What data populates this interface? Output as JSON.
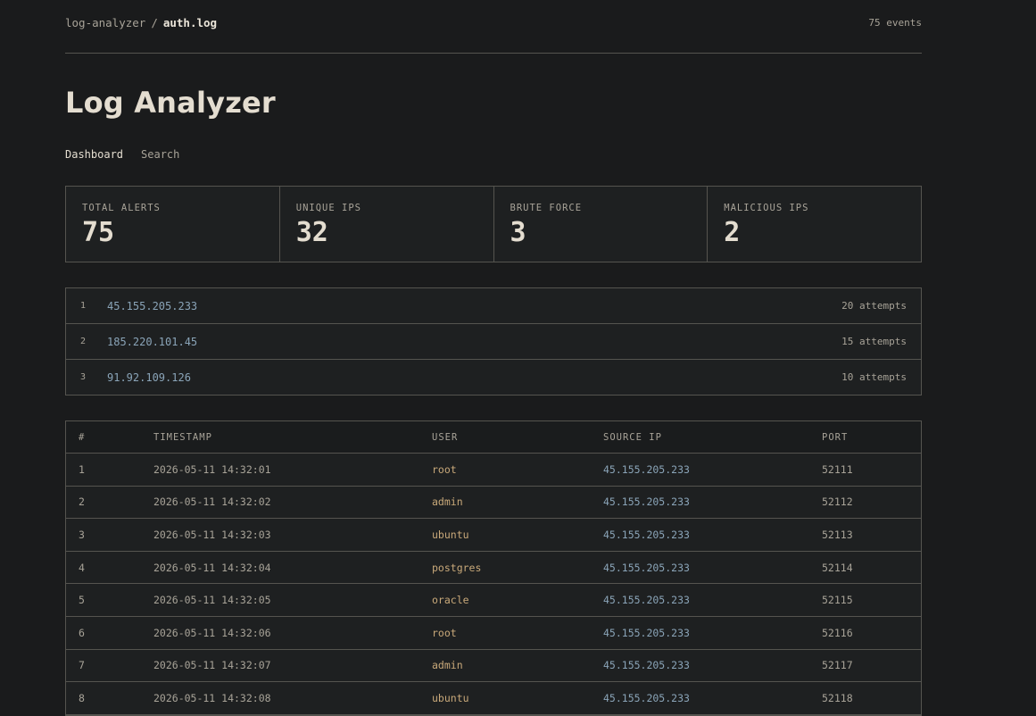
{
  "breadcrumb": {
    "app": "log-analyzer",
    "separator": "/",
    "file": "auth.log"
  },
  "event_count": "75 events",
  "title": "Log Analyzer",
  "tabs": [
    {
      "label": "Dashboard",
      "active": true
    },
    {
      "label": "Search",
      "active": false
    }
  ],
  "stats": [
    {
      "label": "TOTAL ALERTS",
      "value": "75"
    },
    {
      "label": "UNIQUE IPS",
      "value": "32"
    },
    {
      "label": "BRUTE FORCE",
      "value": "3"
    },
    {
      "label": "MALICIOUS IPS",
      "value": "2"
    }
  ],
  "top_ips": [
    {
      "rank": "1",
      "ip": "45.155.205.233",
      "attempts": "20 attempts"
    },
    {
      "rank": "2",
      "ip": "185.220.101.45",
      "attempts": "15 attempts"
    },
    {
      "rank": "3",
      "ip": "91.92.109.126",
      "attempts": "10 attempts"
    }
  ],
  "events": {
    "columns": [
      "#",
      "TIMESTAMP",
      "USER",
      "SOURCE IP",
      "PORT"
    ],
    "rows": [
      {
        "num": "1",
        "ts": "2026-05-11 14:32:01",
        "user": "root",
        "ip": "45.155.205.233",
        "port": "52111"
      },
      {
        "num": "2",
        "ts": "2026-05-11 14:32:02",
        "user": "admin",
        "ip": "45.155.205.233",
        "port": "52112"
      },
      {
        "num": "3",
        "ts": "2026-05-11 14:32:03",
        "user": "ubuntu",
        "ip": "45.155.205.233",
        "port": "52113"
      },
      {
        "num": "4",
        "ts": "2026-05-11 14:32:04",
        "user": "postgres",
        "ip": "45.155.205.233",
        "port": "52114"
      },
      {
        "num": "5",
        "ts": "2026-05-11 14:32:05",
        "user": "oracle",
        "ip": "45.155.205.233",
        "port": "52115"
      },
      {
        "num": "6",
        "ts": "2026-05-11 14:32:06",
        "user": "root",
        "ip": "45.155.205.233",
        "port": "52116"
      },
      {
        "num": "7",
        "ts": "2026-05-11 14:32:07",
        "user": "admin",
        "ip": "45.155.205.233",
        "port": "52117"
      },
      {
        "num": "8",
        "ts": "2026-05-11 14:32:08",
        "user": "ubuntu",
        "ip": "45.155.205.233",
        "port": "52118"
      }
    ]
  },
  "colors": {
    "background": "#1a1b1c",
    "panel": "#1e2021",
    "border": "#55544f",
    "ip_link": "#8aa4b8",
    "user_accent": "#c9a97a"
  }
}
